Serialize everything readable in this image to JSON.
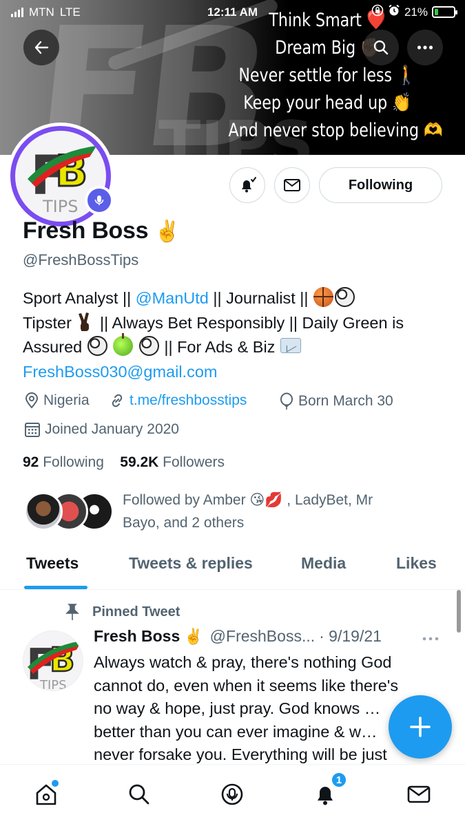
{
  "status_bar": {
    "carrier": "MTN",
    "network": "LTE",
    "time": "12:11 AM",
    "battery": "21%",
    "battery_level": 0.21
  },
  "banner": {
    "motto_lines": [
      "Think Smart ❤️",
      "Dream Big ✊🏽",
      "Never settle for less 🚶",
      "Keep your head up 👏",
      "And never stop believing 🫶"
    ]
  },
  "profile": {
    "display_name": "Fresh Boss",
    "name_emoji": "✌️",
    "handle": "@FreshBossTips",
    "bio": {
      "line1_a": "Sport Analyst || ",
      "line1_link": "@ManUtd",
      "line1_b": " || Journalist || ",
      "line2_a": "Tipster ",
      "line2_b": " || Always Bet Responsibly || Daily Green is",
      "line3_a": "Assured ",
      "line3_b": " || For Ads & Biz ",
      "email": "FreshBoss030@gmail.com"
    },
    "location": "Nigeria",
    "website": "t.me/freshbosstips",
    "birthday": "Born March 30",
    "joined": "Joined January 2020",
    "following_count": "92",
    "following_label": "Following",
    "followers_count": "59.2K",
    "followers_label": "Followers",
    "followed_by_line1": "Followed by Amber 😘💋 , LadyBet, Mr",
    "followed_by_line2": "Bayo, and 2 others",
    "follow_button_label": "Following"
  },
  "tabs": [
    "Tweets",
    "Tweets & replies",
    "Media",
    "Likes"
  ],
  "active_tab": "Tweets",
  "pinned_tweet": {
    "label": "Pinned Tweet",
    "author": "Fresh Boss",
    "author_emoji": "✌️",
    "handle_truncated": "@FreshBoss...",
    "date": "· 9/19/21",
    "text_lines": [
      "Always watch & pray, there's nothing God",
      "cannot do, even when it seems like there's",
      "no way & hope, just pray. God knows …",
      "better than you can ever imagine & w…",
      "never forsake you. Everything will be just"
    ]
  },
  "nav": {
    "notifications_count": "1"
  },
  "colors": {
    "accent": "#1d9bf0",
    "text_primary": "#0f1419",
    "text_secondary": "#536471",
    "avatar_ring": "#7b4cf0",
    "spaces_badge": "#5b5fe8"
  },
  "icons": [
    "back-arrow-icon",
    "search-icon",
    "more-icon",
    "spaces-mic-icon",
    "bell-icon",
    "mail-icon",
    "location-icon",
    "link-icon",
    "balloon-icon",
    "calendar-icon",
    "pin-icon",
    "home-icon",
    "search-icon",
    "spaces-icon",
    "bell-icon",
    "mail-icon",
    "plus-icon"
  ]
}
